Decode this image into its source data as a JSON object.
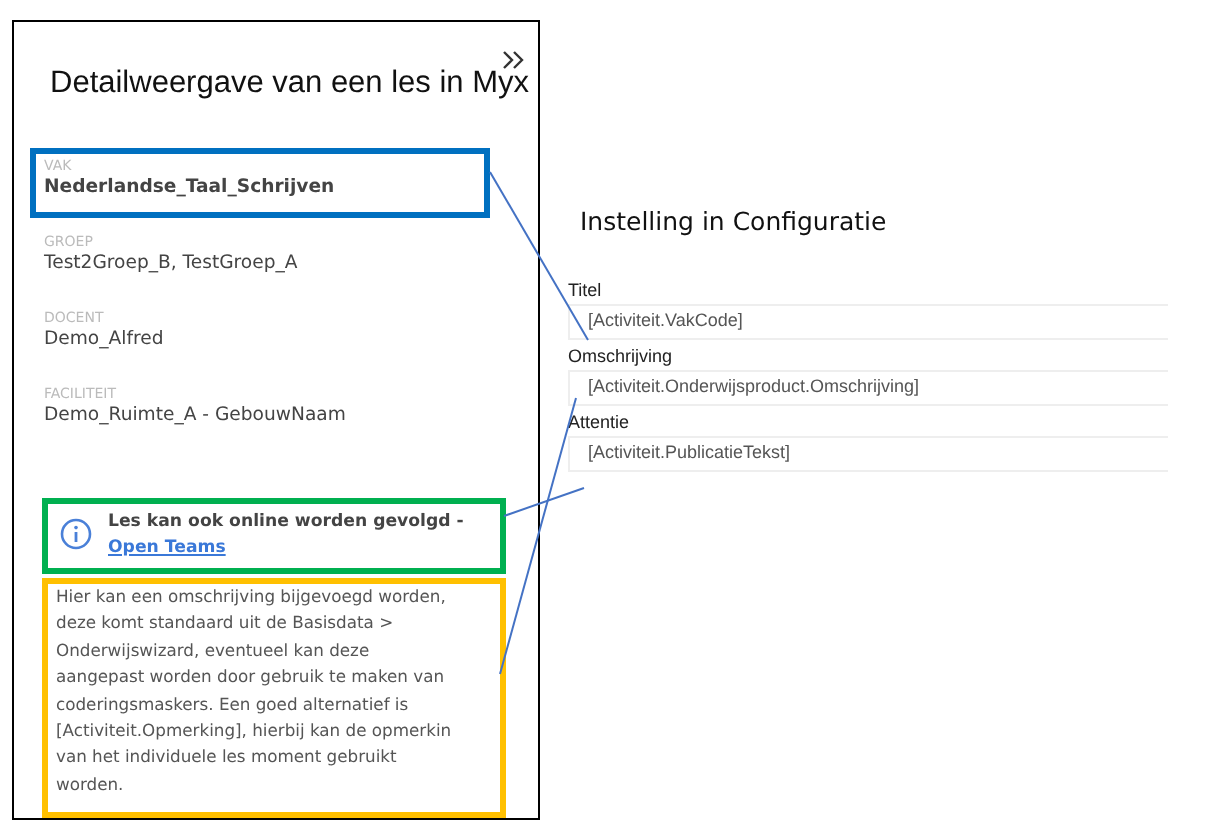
{
  "detail_panel": {
    "title": "Detailweergave van een les in Myx",
    "fields": [
      {
        "label": "VAK",
        "value": "Nederlandse_Taal_Schrijven",
        "emphasis": true,
        "color": "#0070c0"
      },
      {
        "label": "GROEP",
        "value": "Test2Groep_B, TestGroep_A",
        "emphasis": false
      },
      {
        "label": "DOCENT",
        "value": "Demo_Alfred",
        "emphasis": false
      },
      {
        "label": "FACILITEIT",
        "value": "Demo_Ruimte_A - GebouwNaam",
        "emphasis": false
      }
    ],
    "notice": {
      "text": "Les kan ook online worden gevolgd -",
      "link": "Open Teams",
      "color": "#00b050"
    },
    "description": {
      "lines": [
        "Hier kan een omschrijving bijgevoegd worden,",
        "deze komt standaard uit de Basisdata >",
        "Onderwijswizard, eventueel kan deze",
        "aangepast worden door gebruik te maken van",
        "coderingsmaskers. Een goed alternatief is",
        "[Activiteit.Opmerking], hierbij kan de opmerkin",
        "van het individuele les moment gebruikt",
        "worden."
      ],
      "color": "#ffc000"
    }
  },
  "configuration": {
    "title": "Instelling in Configuratie",
    "fields": [
      {
        "label": "Titel",
        "value": "[Activiteit.VakCode]"
      },
      {
        "label": "Omschrijving",
        "value": "[Activiteit.Onderwijsproduct.Omschrijving]"
      },
      {
        "label": "Attentie",
        "value": "[Activiteit.PublicatieTekst]"
      }
    ]
  }
}
